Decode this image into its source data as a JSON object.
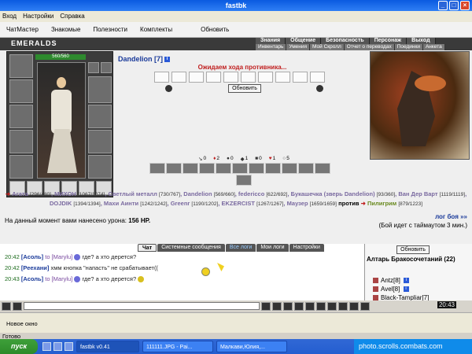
{
  "window": {
    "title": "fastbk"
  },
  "menu": [
    "Вход",
    "Настройки",
    "Справка"
  ],
  "toolbar": [
    "ЧатМастер",
    "Знакомые",
    "Полезности",
    "Комплекты",
    "Обновить"
  ],
  "game": {
    "logo": "EMERALDS",
    "nav_top": [
      "Знания",
      "Общение",
      "Безопасность",
      "Персонаж",
      "Выход"
    ],
    "nav_bottom": [
      "Инвентарь",
      "Умения",
      "Мой Скролл",
      "Отчет о переводах",
      "Поединки",
      "Анкета"
    ],
    "hp": "560/560",
    "player_name": "Dandelion [7]",
    "info_icon": "i",
    "waiting": "Ожидаем хода противника...",
    "refresh": "Обновить",
    "counters": [
      {
        "icon": "sword",
        "value": "0"
      },
      {
        "icon": "crit",
        "value": "2"
      },
      {
        "icon": "dodge",
        "value": "0"
      },
      {
        "icon": "shield",
        "value": "1"
      },
      {
        "icon": "block",
        "value": "0"
      },
      {
        "icon": "heart",
        "value": "1"
      },
      {
        "icon": "counter",
        "value": "5"
      }
    ],
    "team1": [
      {
        "name": "Агата",
        "lvl": "[296/480]"
      },
      {
        "name": "МИХОН",
        "lvl": "[1067/1074]"
      },
      {
        "name": "Светлый металл",
        "lvl": "[730/767]"
      },
      {
        "name": "Dandelion",
        "lvl": "[569/660]"
      },
      {
        "name": "federicco",
        "lvl": "[622/692]"
      },
      {
        "name": "Букашечка (зверь Dandelion)",
        "lvl": "[93/360]"
      },
      {
        "name": "Ван Дер Варт",
        "lvl": "[1119/1119]"
      },
      {
        "name": "DOJDIK",
        "lvl": "[1394/1394]"
      },
      {
        "name": "Махи Аинти",
        "lvl": "[1242/1242]"
      },
      {
        "name": "Greenr",
        "lvl": "[1190/1202]"
      },
      {
        "name": "EKZERCIST",
        "lvl": "[1267/1267]"
      },
      {
        "name": "Маузер",
        "lvl": "[1659/1659]"
      }
    ],
    "vs": "против",
    "team2": [
      {
        "name": "Пилигрим",
        "lvl": "[879/1223]"
      }
    ],
    "damage_label": "На данный момент вами нанесено урона:",
    "damage_value": "156 HP.",
    "log_link": "лог боя »»",
    "timeout": "(Бой идет с таймаутом 3 мин.)"
  },
  "chat": {
    "tabs": [
      "Чат",
      "Системные сообщения",
      "Все логи",
      "Мои логи",
      "Настройки"
    ],
    "messages": [
      {
        "time": "20:42",
        "nick": "[Асоль]",
        "to": "to [Marylu]",
        "text": "где? а хто дерется?"
      },
      {
        "time": "20:42",
        "nick": "[Реехани]",
        "to": "",
        "text": "хмм кнопка \"напасть\" не срабатывает(("
      },
      {
        "time": "20:43",
        "nick": "[Асоль]",
        "to": "to [Marylu]",
        "text": "где? а хто дерется?"
      }
    ]
  },
  "side": {
    "refresh": "Обновить",
    "location": "Алтарь Бракосочетаний (22)",
    "users": [
      "Antz[8]",
      "Avel[8]",
      "Black-Tampliar[7]"
    ]
  },
  "inputbar": {
    "clock": "20:43"
  },
  "statusbar": {
    "new_window": "Новое окно",
    "ready": "Готово"
  },
  "taskbar": {
    "start": "пуск",
    "tasks": [
      "fastbk v0.41",
      "111111.JPG - Pai...",
      "Малкави,Юлия,..."
    ],
    "tray": "photo.scrolls.combats.com"
  },
  "colors": {
    "title_blue": "#0a5ae0",
    "link_blue": "#1a3a9a",
    "red": "#c02020"
  }
}
